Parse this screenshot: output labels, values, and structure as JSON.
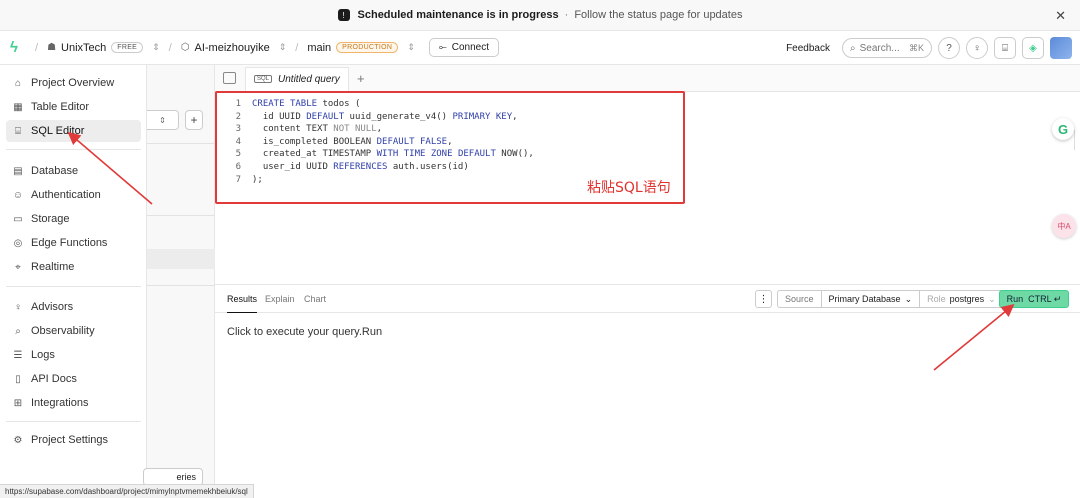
{
  "banner": {
    "icon": "maintenance-icon",
    "title": "Scheduled maintenance is in progress",
    "separator": "·",
    "subtitle": "Follow the status page for updates",
    "close": "✕"
  },
  "topnav": {
    "org": "UnixTech",
    "org_plan": "FREE",
    "project": "AI-meizhouyike",
    "branch": "main",
    "branch_badge": "PRODUCTION",
    "connect": "Connect",
    "feedback": "Feedback",
    "search_placeholder": "Search...",
    "search_shortcut": "⌘K"
  },
  "sidebar": {
    "items": [
      {
        "label": "Project Overview",
        "icon": "home-icon"
      },
      {
        "label": "Table Editor",
        "icon": "table-icon"
      },
      {
        "label": "SQL Editor",
        "icon": "terminal-icon",
        "active": true
      },
      {
        "label": "Database",
        "icon": "database-icon"
      },
      {
        "label": "Authentication",
        "icon": "users-icon"
      },
      {
        "label": "Storage",
        "icon": "archive-icon"
      },
      {
        "label": "Edge Functions",
        "icon": "globe-icon"
      },
      {
        "label": "Realtime",
        "icon": "realtime-icon"
      },
      {
        "label": "Advisors",
        "icon": "lightbulb-icon"
      },
      {
        "label": "Observability",
        "icon": "telescope-icon"
      },
      {
        "label": "Logs",
        "icon": "list-icon"
      },
      {
        "label": "API Docs",
        "icon": "file-icon"
      },
      {
        "label": "Integrations",
        "icon": "grid-icon"
      },
      {
        "label": "Project Settings",
        "icon": "gear-icon"
      }
    ]
  },
  "panel2": {
    "button_fragment": "eries"
  },
  "editor": {
    "tab_label": "Untitled query",
    "tab_badge": "SQL",
    "code_lines": [
      "CREATE TABLE todos (",
      "  id UUID DEFAULT uuid_generate_v4() PRIMARY KEY,",
      "  content TEXT NOT NULL,",
      "  is_completed BOOLEAN DEFAULT FALSE,",
      "  created_at TIMESTAMP WITH TIME ZONE DEFAULT NOW(),",
      "  user_id UUID REFERENCES auth.users(id)",
      ");"
    ],
    "annotation": "粘贴SQL语句"
  },
  "results": {
    "tabs": [
      "Results",
      "Explain",
      "Chart"
    ],
    "source_label": "Source",
    "database": "Primary Database",
    "role_label": "Role",
    "role_value": "postgres",
    "run_label": "Run",
    "run_shortcut": "CTRL ↵",
    "message": "Click to execute your query.Run"
  },
  "status_url": "https://supabase.com/dashboard/project/mimylnptvmemekhbeiuk/sql",
  "colors": {
    "accent": "#3ecf8e",
    "annotation_red": "#e03a3a",
    "production_badge": "#c7781a"
  }
}
